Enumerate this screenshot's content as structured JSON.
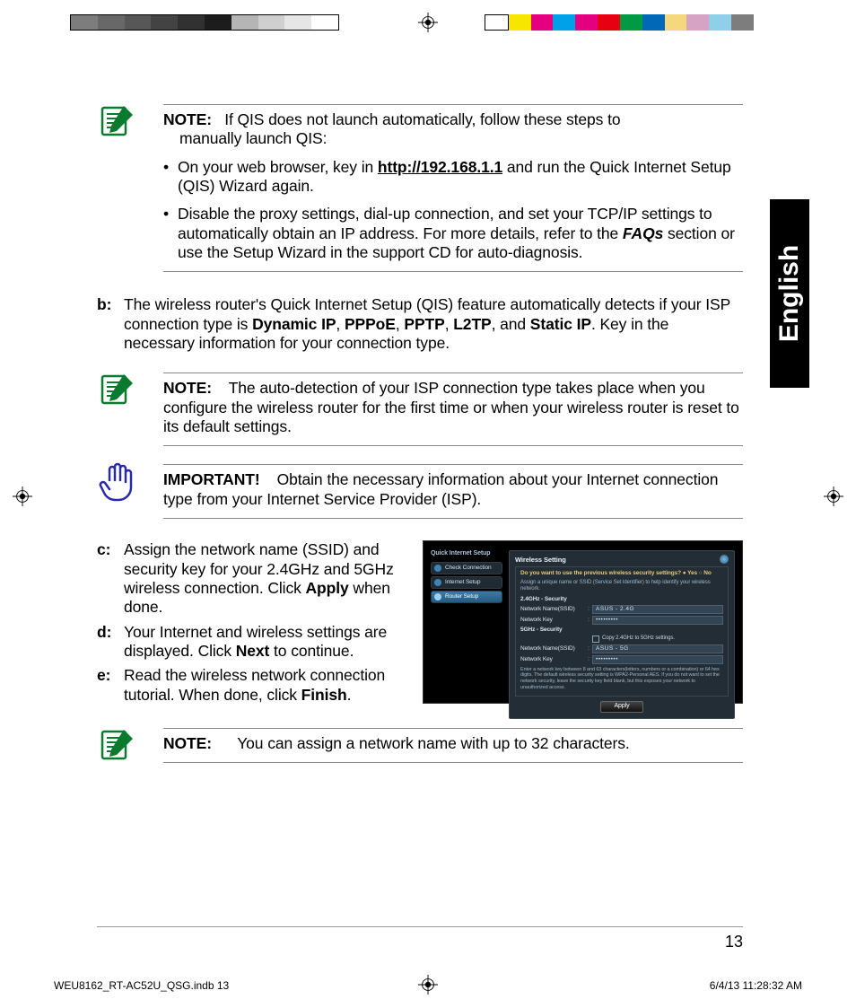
{
  "print_marks": {
    "left_swatches": [
      "#7d7d7d",
      "#686868",
      "#575757",
      "#434343",
      "#313131",
      "#1c1c1c",
      "#b5b5b5",
      "#cfcfcf",
      "#e6e6e6",
      "#ffffff"
    ],
    "right_swatches": [
      "#ffffff",
      "#f7e600",
      "#e4007f",
      "#00a1e9",
      "#e4007f",
      "#e60012",
      "#009944",
      "#0068b7",
      "#f5d77d",
      "#d6a3c4",
      "#8fd0e8",
      "#7d7d7d"
    ]
  },
  "lang_tab": "English",
  "note1": {
    "label": "NOTE:",
    "lead_a": "If QIS does not launch automatically, follow these steps to",
    "lead_b": "manually launch QIS:",
    "bullet1_a": "On your web browser, key in ",
    "bullet1_link": "http://192.168.1.1",
    "bullet1_b": " and run the Quick Internet Setup (QIS) Wizard again.",
    "bullet2_a": "Disable the proxy settings, dial-up connection, and set your TCP/IP settings to automatically obtain an IP address. For more details, refer to the ",
    "bullet2_faqs": "FAQs",
    "bullet2_b": " section or use the Setup Wizard in the support CD for auto-diagnosis."
  },
  "step_b": {
    "label": "b:",
    "t1": "The wireless router's Quick Internet Setup (QIS) feature automatically detects if your ISP connection type is ",
    "dyn": "Dynamic IP",
    "c1": ", ",
    "ppp": "PPPoE",
    "c2": ", ",
    "pptp": "PPTP",
    "c3": ", ",
    "l2tp": "L2TP",
    "c4": ", and ",
    "sip": "Static IP",
    "t2": ". Key in the necessary information for your connection type."
  },
  "note2": {
    "label": "NOTE:",
    "text": " The auto-detection of your ISP connection type takes place when you configure the wireless router for the first time or when your wireless router is reset to its default settings."
  },
  "important": {
    "label": "IMPORTANT!",
    "text": " Obtain the necessary information about your Internet connection type from your Internet Service Provider (ISP)."
  },
  "step_c": {
    "label": "c:",
    "t1": "Assign the network name (SSID) and security key for your 2.4GHz and 5GHz wireless connection. Click ",
    "apply": "Apply",
    "t2": " when done."
  },
  "step_d": {
    "label": "d:",
    "t1": "Your Internet and wireless settings are displayed. Click ",
    "next": "Next",
    "t2": " to continue."
  },
  "step_e": {
    "label": "e:",
    "t1": "Read the wireless network connection tutorial. When done, click ",
    "finish": "Finish",
    "t2": "."
  },
  "note3": {
    "label": "NOTE:",
    "text": " You can assign a network name with up to 32 characters."
  },
  "router_ui": {
    "qis_header": "Quick Internet Setup",
    "steps": [
      "Check Connection",
      "Internet Setup",
      "Router Setup"
    ],
    "panel_title": "Wireless Setting",
    "question": "Do you want to use the previous wireless security settings?  ● Yes  ○ No",
    "desc": "Assign a unique name or SSID (Service Set Identifier) to help identify your wireless network.",
    "sec24": "2.4GHz - Security",
    "nn": "Network Name(SSID)",
    "nk": "Network Key",
    "sec5": "5GHz - Security",
    "ssid24": "ASUS - 2.4G",
    "ssid5": "ASUS - 5G",
    "mask": "•••••••••",
    "copy": "Copy 2.4GHz to 5GHz settings.",
    "note": "Enter a network key between 8 and 63 characters(letters, numbers or a combination) or 64 hex digits. The default wireless security setting is WPA2-Personal AES. If you do not want to set the network security, leave the security key field blank, but this exposes your network to unauthorized access.",
    "apply": "Apply"
  },
  "page_number": "13",
  "footer": {
    "file": "WEU8162_RT-AC52U_QSG.indb   13",
    "date": "6/4/13   11:28:32 AM"
  }
}
